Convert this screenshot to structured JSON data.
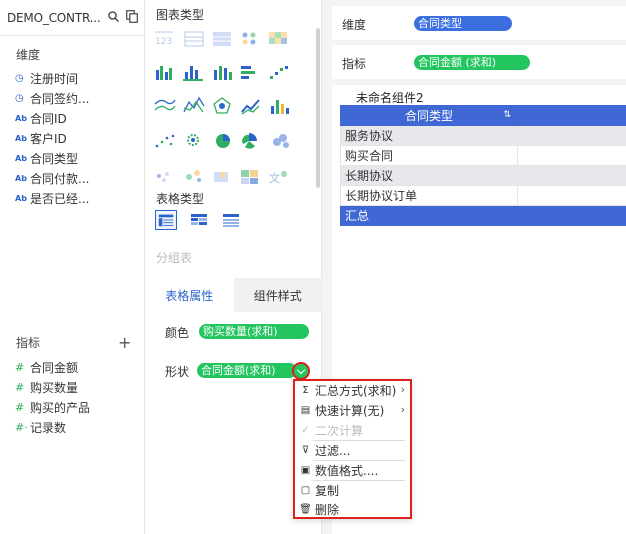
{
  "data_source": {
    "title": "DEMO_CONTR...",
    "dimensions_label": "维度",
    "dimensions": [
      {
        "icon": "clock-icon",
        "glyph": "◷",
        "label": "注册时间"
      },
      {
        "icon": "clock-icon",
        "glyph": "◷",
        "label": "合同签约..."
      },
      {
        "icon": "text-type-icon",
        "glyph": "Ab",
        "label": "合同ID"
      },
      {
        "icon": "text-type-icon",
        "glyph": "Ab",
        "label": "客户ID"
      },
      {
        "icon": "text-type-icon",
        "glyph": "Ab",
        "label": "合同类型"
      },
      {
        "icon": "text-type-icon",
        "glyph": "Ab",
        "label": "合同付款..."
      },
      {
        "icon": "text-type-icon",
        "glyph": "Ab",
        "label": "是否已经..."
      }
    ],
    "measures_label": "指标",
    "add_glyph": "+",
    "measures": [
      {
        "glyph": "#",
        "label": "合同金额"
      },
      {
        "glyph": "#",
        "label": "购买数量"
      },
      {
        "glyph": "#",
        "label": "购买的产品"
      },
      {
        "glyph": "#·",
        "label": "记录数"
      }
    ]
  },
  "chart_panel": {
    "chart_types_label": "图表类型",
    "table_types_label": "表格类型",
    "group_table_label": "分组表",
    "tabs": [
      {
        "label": "表格属性",
        "active": true
      },
      {
        "label": "组件样式",
        "active": false
      }
    ],
    "color_label": "颜色",
    "color_field": "购买数量(求和)",
    "shape_label": "形状",
    "shape_field": "合同金额(求和)"
  },
  "shelves": {
    "dimension_label": "维度",
    "dimension_field": "合同类型",
    "measure_label": "指标",
    "measure_field": "合同金额 (求和)"
  },
  "widget": {
    "title": "未命名组件2",
    "header": "合同类型",
    "sort_glyph": "⇅",
    "rows": [
      "服务协议",
      "购买合同",
      "长期协议",
      "长期协议订单"
    ],
    "total": "汇总"
  },
  "menu": {
    "items": [
      {
        "glyph": "Σ",
        "label": "汇总方式(求和)",
        "submenu": true,
        "disabled": false
      },
      {
        "glyph": "▤",
        "label": "快速计算(无)",
        "submenu": true,
        "disabled": false
      },
      {
        "glyph": "✓",
        "label": "二次计算",
        "submenu": false,
        "disabled": true
      },
      {
        "glyph": "⊽",
        "label": "过滤...",
        "submenu": false,
        "disabled": false
      },
      {
        "glyph": "▣",
        "label": "数值格式....",
        "submenu": false,
        "disabled": false
      },
      {
        "glyph": "▢",
        "label": "复制",
        "submenu": false,
        "disabled": false
      },
      {
        "glyph": "🗑",
        "label": "删除",
        "submenu": false,
        "disabled": false
      }
    ]
  },
  "colors": {
    "accent": "#3f68d4",
    "pill_green": "#22c55e",
    "highlight_red": "#e0201b"
  }
}
